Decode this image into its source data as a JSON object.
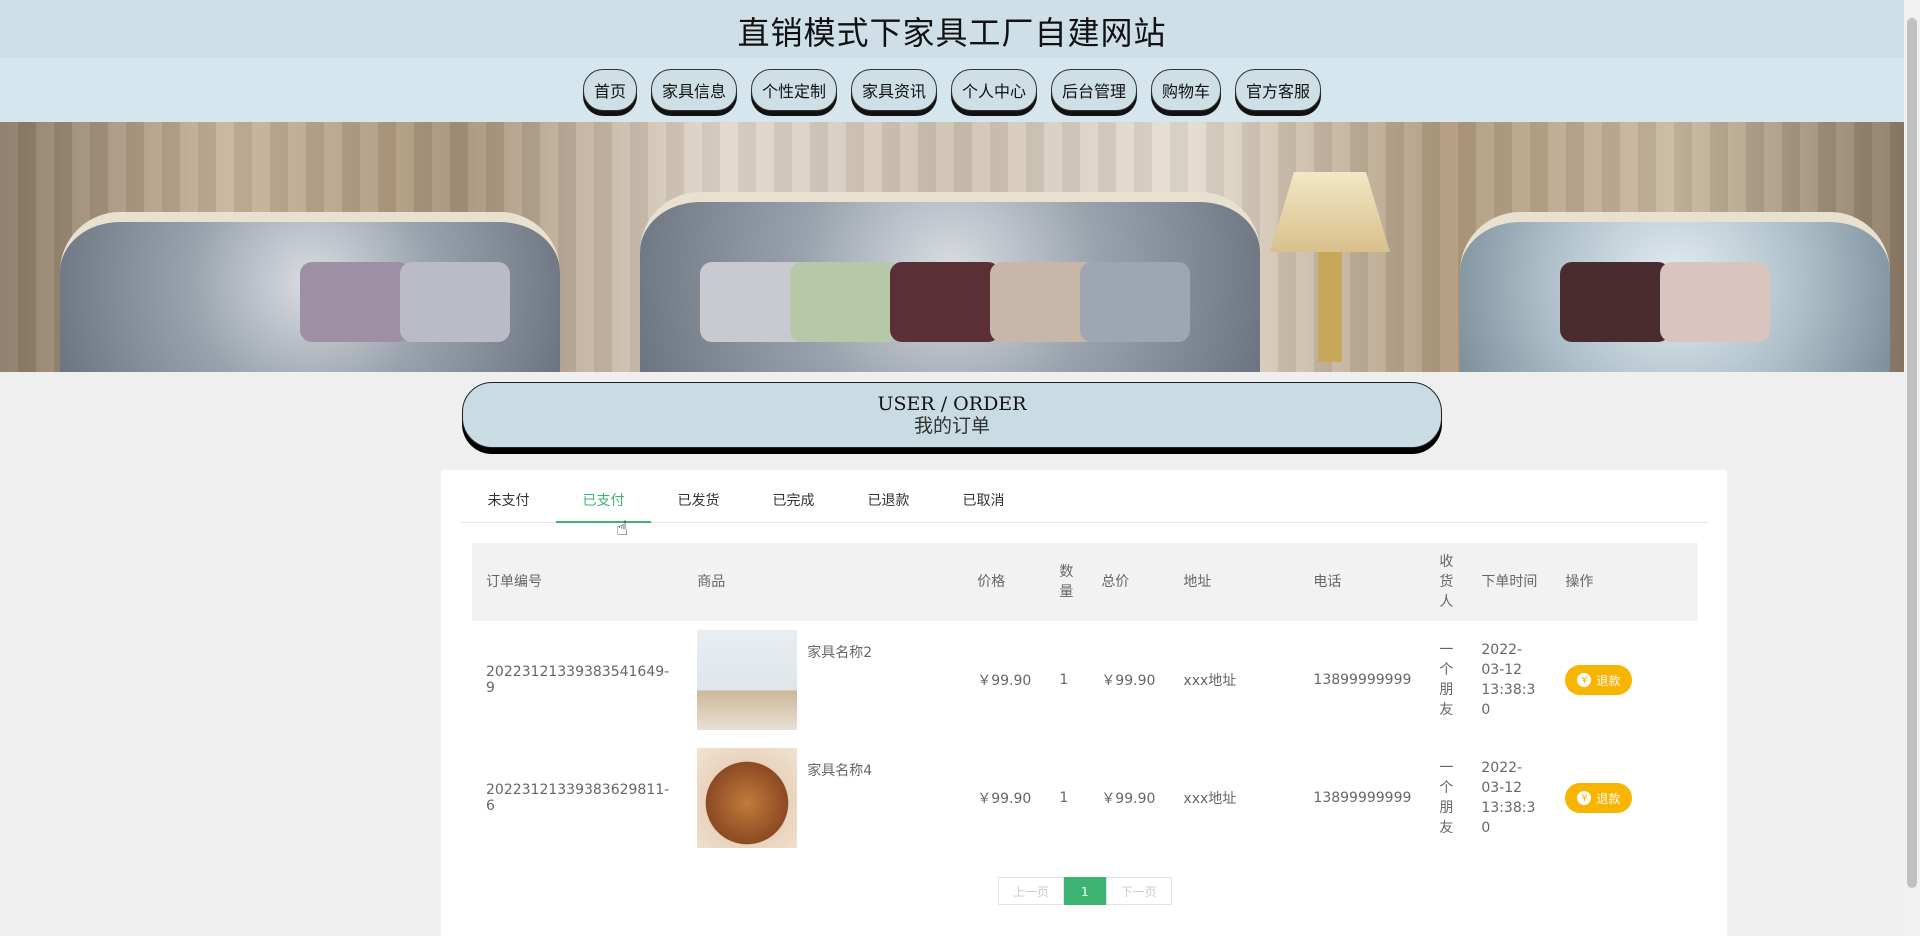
{
  "site": {
    "title": "直销模式下家具工厂自建网站"
  },
  "nav": {
    "items": [
      "首页",
      "家具信息",
      "个性定制",
      "家具资讯",
      "个人中心",
      "后台管理",
      "购物车",
      "官方客服"
    ]
  },
  "heading": {
    "en": "USER / ORDER",
    "cn": "我的订单"
  },
  "tabs": [
    {
      "label": "未支付",
      "active": false
    },
    {
      "label": "已支付",
      "active": true
    },
    {
      "label": "已发货",
      "active": false
    },
    {
      "label": "已完成",
      "active": false
    },
    {
      "label": "已退款",
      "active": false
    },
    {
      "label": "已取消",
      "active": false
    }
  ],
  "table": {
    "headers": [
      "订单编号",
      "商品",
      "价格",
      "数量",
      "总价",
      "地址",
      "电话",
      "收货人",
      "下单时间",
      "操作"
    ],
    "rows": [
      {
        "order_no": "20223121339383541649­9",
        "product": "家具名称2",
        "price": "￥99.90",
        "qty": "1",
        "total": "￥99.90",
        "address": "xxx地址",
        "phone": "13899999999",
        "receiver": "一个朋友",
        "time": "2022-03-12 13:38:30",
        "action": "退款"
      },
      {
        "order_no": "20223121339383629811­6",
        "product": "家具名称4",
        "price": "￥99.90",
        "qty": "1",
        "total": "￥99.90",
        "address": "xxx地址",
        "phone": "13899999999",
        "receiver": "一个朋友",
        "time": "2022-03-12 13:38:30",
        "action": "退款"
      }
    ]
  },
  "pager": {
    "prev": "上一页",
    "current": "1",
    "next": "下一页"
  },
  "colors": {
    "accent": "#3cb371",
    "refund": "#f7b500",
    "header_bg": "#cfdfe8"
  }
}
